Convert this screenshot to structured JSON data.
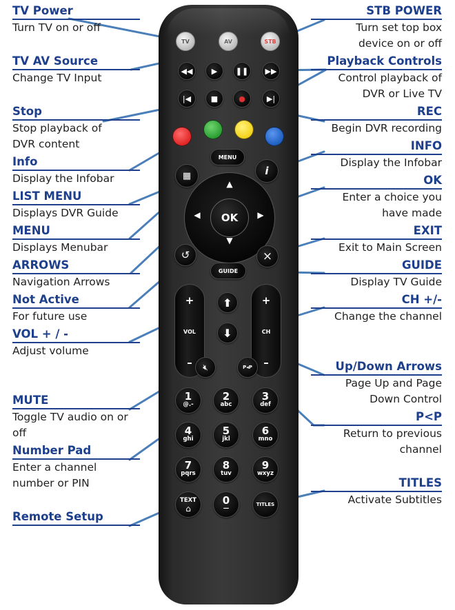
{
  "colors": {
    "annotation_title": "#1d3f8c",
    "leader_line": "#4a7fb9",
    "red": "#e12626",
    "green": "#2ca033",
    "yellow": "#f2d21a",
    "blue": "#1e5fc0"
  },
  "annotations_left": [
    {
      "title": "TV Power",
      "desc": "Turn TV on or off"
    },
    {
      "title": "TV AV Source",
      "desc": "Change TV Input"
    },
    {
      "title": "Stop",
      "desc": "Stop playback of DVR content"
    },
    {
      "title": "Info",
      "desc": "Display the Infobar"
    },
    {
      "title": "LIST MENU",
      "desc": "Displays DVR Guide"
    },
    {
      "title": "MENU",
      "desc": "Displays Menubar"
    },
    {
      "title": "ARROWS",
      "desc": "Navigation Arrows"
    },
    {
      "title": "Not Active",
      "desc": "For future use"
    },
    {
      "title": "VOL + / -",
      "desc": "Adjust volume"
    },
    {
      "title": "MUTE",
      "desc": "Toggle TV audio on or off"
    },
    {
      "title": "Number Pad",
      "desc": "Enter a channel number or PIN"
    },
    {
      "title": "Remote Setup",
      "desc": ""
    }
  ],
  "annotations_right": [
    {
      "title": "STB POWER",
      "desc": "Turn set top box device on or off"
    },
    {
      "title": "Playback Controls",
      "desc": "Control playback of DVR or Live TV"
    },
    {
      "title": "REC",
      "desc": "Begin DVR recording"
    },
    {
      "title": "INFO",
      "desc": "Display the Infobar"
    },
    {
      "title": "OK",
      "desc": "Enter a choice you have made"
    },
    {
      "title": "EXIT",
      "desc": "Exit to Main Screen"
    },
    {
      "title": "GUIDE",
      "desc": "Display TV Guide"
    },
    {
      "title": "CH +/-",
      "desc": "Change the channel"
    },
    {
      "title": "Up/Down Arrows",
      "desc": "Page Up and Page Down Control"
    },
    {
      "title": "P<P",
      "desc": "Return to previous channel"
    },
    {
      "title": "TITLES",
      "desc": "Activate Subtitles"
    }
  ],
  "remote": {
    "tv_power": "TV",
    "av": "AV",
    "stb": "STB",
    "menu": "MENU",
    "ok": "OK",
    "guide": "GUIDE",
    "vol": "VOL",
    "ch": "CH",
    "plus": "+",
    "minus": "–",
    "p_p": "P◂P",
    "text": "TEXT",
    "titles": "TITLES",
    "info_glyph": "i",
    "exit_glyph": "×",
    "numpad": [
      {
        "n": "1",
        "l": "@.-"
      },
      {
        "n": "2",
        "l": "abc"
      },
      {
        "n": "3",
        "l": "def"
      },
      {
        "n": "4",
        "l": "ghi"
      },
      {
        "n": "5",
        "l": "jkl"
      },
      {
        "n": "6",
        "l": "mno"
      },
      {
        "n": "7",
        "l": "pqrs"
      },
      {
        "n": "8",
        "l": "tuv"
      },
      {
        "n": "9",
        "l": "wxyz"
      },
      {
        "n": "0",
        "l": "—"
      }
    ]
  }
}
